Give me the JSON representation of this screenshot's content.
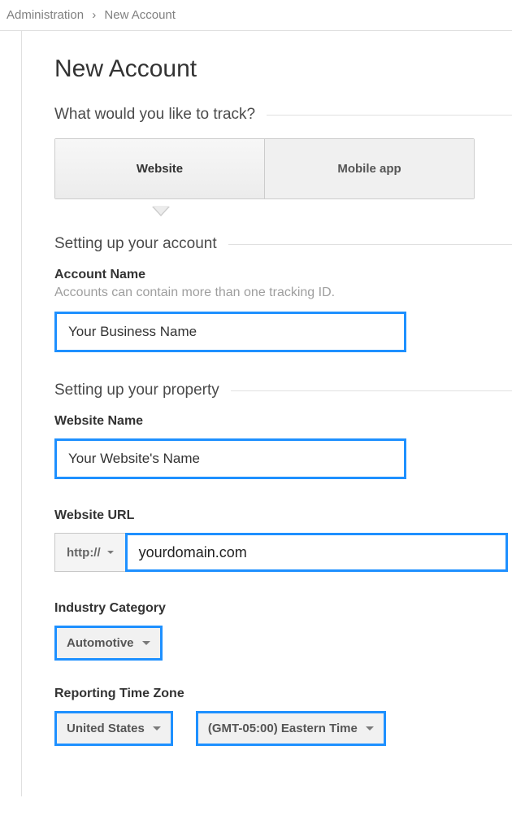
{
  "breadcrumb": {
    "parent": "Administration",
    "current": "New Account"
  },
  "page_title": "New Account",
  "sections": {
    "track": {
      "heading": "What would you like to track?",
      "tabs": [
        {
          "label": "Website",
          "active": true
        },
        {
          "label": "Mobile app",
          "active": false
        }
      ]
    },
    "account": {
      "heading": "Setting up your account",
      "account_name": {
        "label": "Account Name",
        "hint": "Accounts can contain more than one tracking ID.",
        "value": "Your Business Name"
      }
    },
    "property": {
      "heading": "Setting up your property",
      "website_name": {
        "label": "Website Name",
        "value": "Your Website's Name"
      },
      "website_url": {
        "label": "Website URL",
        "protocol": "http://",
        "value": "yourdomain.com"
      },
      "industry": {
        "label": "Industry Category",
        "value": "Automotive"
      },
      "timezone": {
        "label": "Reporting Time Zone",
        "country": "United States",
        "tz": "(GMT-05:00) Eastern Time"
      }
    }
  }
}
